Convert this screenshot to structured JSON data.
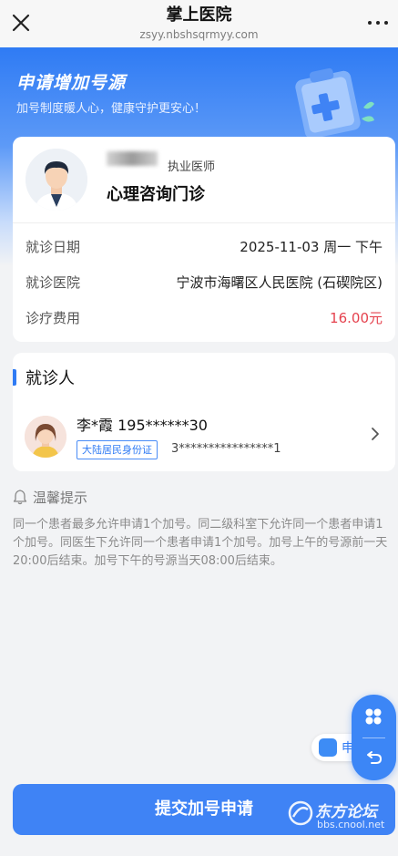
{
  "browser": {
    "title": "掌上医院",
    "domain": "zsyy.nbshsqrmyy.com",
    "close_icon": "close-icon",
    "more_icon": "more-dots-icon"
  },
  "hero": {
    "title": "申请增加号源",
    "subtitle": "加号制度暖人心，健康守护更安心！"
  },
  "doctor": {
    "title": "执业医师",
    "department": "心理咨询门诊",
    "rows": [
      {
        "label": "就诊日期",
        "value": "2025-11-03 周一 下午"
      },
      {
        "label": "就诊医院",
        "value": "宁波市海曙区人民医院 (石碶院区)"
      },
      {
        "label": "诊疗费用",
        "value": "16.00元"
      }
    ],
    "fee_color": "#e5424e"
  },
  "patient": {
    "section_title": "就诊人",
    "name_phone": "李*霞 195******30",
    "id_type": "大陆居民身份证",
    "id_number": "3****************1"
  },
  "tips": {
    "title": "温馨提示",
    "text": "同一个患者最多允许申请1个加号。同二级科室下允许同一个患者申请1个加号。同医生下允许同一个患者申请1个加号。加号上午的号源前一天20:00后结束。加号下午的号源当天08:00后结束。"
  },
  "float": {
    "pill_text": "申"
  },
  "submit": {
    "label": "提交加号申请"
  },
  "watermark": {
    "text": "东方论坛",
    "url": "bbs.cnool.net"
  },
  "colors": {
    "accent": "#2f7bf4",
    "background": "#f2f3f5"
  }
}
